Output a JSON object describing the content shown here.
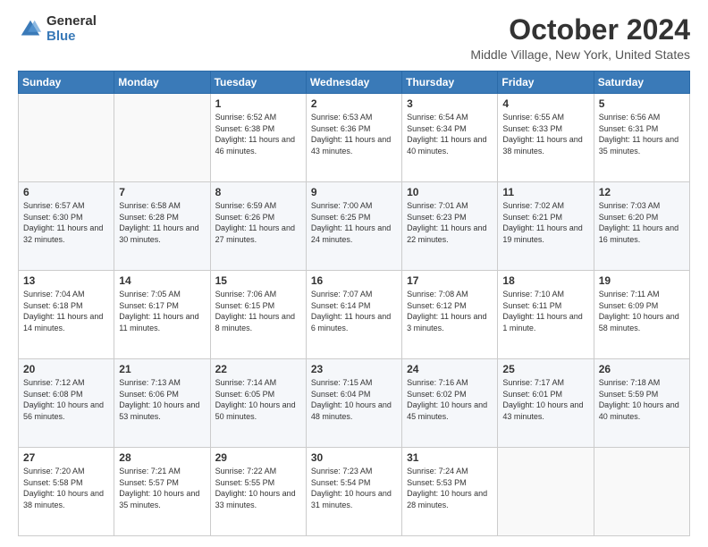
{
  "logo": {
    "general": "General",
    "blue": "Blue"
  },
  "title": "October 2024",
  "location": "Middle Village, New York, United States",
  "days_of_week": [
    "Sunday",
    "Monday",
    "Tuesday",
    "Wednesday",
    "Thursday",
    "Friday",
    "Saturday"
  ],
  "weeks": [
    [
      {
        "day": "",
        "sunrise": "",
        "sunset": "",
        "daylight": ""
      },
      {
        "day": "",
        "sunrise": "",
        "sunset": "",
        "daylight": ""
      },
      {
        "day": "1",
        "sunrise": "Sunrise: 6:52 AM",
        "sunset": "Sunset: 6:38 PM",
        "daylight": "Daylight: 11 hours and 46 minutes."
      },
      {
        "day": "2",
        "sunrise": "Sunrise: 6:53 AM",
        "sunset": "Sunset: 6:36 PM",
        "daylight": "Daylight: 11 hours and 43 minutes."
      },
      {
        "day": "3",
        "sunrise": "Sunrise: 6:54 AM",
        "sunset": "Sunset: 6:34 PM",
        "daylight": "Daylight: 11 hours and 40 minutes."
      },
      {
        "day": "4",
        "sunrise": "Sunrise: 6:55 AM",
        "sunset": "Sunset: 6:33 PM",
        "daylight": "Daylight: 11 hours and 38 minutes."
      },
      {
        "day": "5",
        "sunrise": "Sunrise: 6:56 AM",
        "sunset": "Sunset: 6:31 PM",
        "daylight": "Daylight: 11 hours and 35 minutes."
      }
    ],
    [
      {
        "day": "6",
        "sunrise": "Sunrise: 6:57 AM",
        "sunset": "Sunset: 6:30 PM",
        "daylight": "Daylight: 11 hours and 32 minutes."
      },
      {
        "day": "7",
        "sunrise": "Sunrise: 6:58 AM",
        "sunset": "Sunset: 6:28 PM",
        "daylight": "Daylight: 11 hours and 30 minutes."
      },
      {
        "day": "8",
        "sunrise": "Sunrise: 6:59 AM",
        "sunset": "Sunset: 6:26 PM",
        "daylight": "Daylight: 11 hours and 27 minutes."
      },
      {
        "day": "9",
        "sunrise": "Sunrise: 7:00 AM",
        "sunset": "Sunset: 6:25 PM",
        "daylight": "Daylight: 11 hours and 24 minutes."
      },
      {
        "day": "10",
        "sunrise": "Sunrise: 7:01 AM",
        "sunset": "Sunset: 6:23 PM",
        "daylight": "Daylight: 11 hours and 22 minutes."
      },
      {
        "day": "11",
        "sunrise": "Sunrise: 7:02 AM",
        "sunset": "Sunset: 6:21 PM",
        "daylight": "Daylight: 11 hours and 19 minutes."
      },
      {
        "day": "12",
        "sunrise": "Sunrise: 7:03 AM",
        "sunset": "Sunset: 6:20 PM",
        "daylight": "Daylight: 11 hours and 16 minutes."
      }
    ],
    [
      {
        "day": "13",
        "sunrise": "Sunrise: 7:04 AM",
        "sunset": "Sunset: 6:18 PM",
        "daylight": "Daylight: 11 hours and 14 minutes."
      },
      {
        "day": "14",
        "sunrise": "Sunrise: 7:05 AM",
        "sunset": "Sunset: 6:17 PM",
        "daylight": "Daylight: 11 hours and 11 minutes."
      },
      {
        "day": "15",
        "sunrise": "Sunrise: 7:06 AM",
        "sunset": "Sunset: 6:15 PM",
        "daylight": "Daylight: 11 hours and 8 minutes."
      },
      {
        "day": "16",
        "sunrise": "Sunrise: 7:07 AM",
        "sunset": "Sunset: 6:14 PM",
        "daylight": "Daylight: 11 hours and 6 minutes."
      },
      {
        "day": "17",
        "sunrise": "Sunrise: 7:08 AM",
        "sunset": "Sunset: 6:12 PM",
        "daylight": "Daylight: 11 hours and 3 minutes."
      },
      {
        "day": "18",
        "sunrise": "Sunrise: 7:10 AM",
        "sunset": "Sunset: 6:11 PM",
        "daylight": "Daylight: 11 hours and 1 minute."
      },
      {
        "day": "19",
        "sunrise": "Sunrise: 7:11 AM",
        "sunset": "Sunset: 6:09 PM",
        "daylight": "Daylight: 10 hours and 58 minutes."
      }
    ],
    [
      {
        "day": "20",
        "sunrise": "Sunrise: 7:12 AM",
        "sunset": "Sunset: 6:08 PM",
        "daylight": "Daylight: 10 hours and 56 minutes."
      },
      {
        "day": "21",
        "sunrise": "Sunrise: 7:13 AM",
        "sunset": "Sunset: 6:06 PM",
        "daylight": "Daylight: 10 hours and 53 minutes."
      },
      {
        "day": "22",
        "sunrise": "Sunrise: 7:14 AM",
        "sunset": "Sunset: 6:05 PM",
        "daylight": "Daylight: 10 hours and 50 minutes."
      },
      {
        "day": "23",
        "sunrise": "Sunrise: 7:15 AM",
        "sunset": "Sunset: 6:04 PM",
        "daylight": "Daylight: 10 hours and 48 minutes."
      },
      {
        "day": "24",
        "sunrise": "Sunrise: 7:16 AM",
        "sunset": "Sunset: 6:02 PM",
        "daylight": "Daylight: 10 hours and 45 minutes."
      },
      {
        "day": "25",
        "sunrise": "Sunrise: 7:17 AM",
        "sunset": "Sunset: 6:01 PM",
        "daylight": "Daylight: 10 hours and 43 minutes."
      },
      {
        "day": "26",
        "sunrise": "Sunrise: 7:18 AM",
        "sunset": "Sunset: 5:59 PM",
        "daylight": "Daylight: 10 hours and 40 minutes."
      }
    ],
    [
      {
        "day": "27",
        "sunrise": "Sunrise: 7:20 AM",
        "sunset": "Sunset: 5:58 PM",
        "daylight": "Daylight: 10 hours and 38 minutes."
      },
      {
        "day": "28",
        "sunrise": "Sunrise: 7:21 AM",
        "sunset": "Sunset: 5:57 PM",
        "daylight": "Daylight: 10 hours and 35 minutes."
      },
      {
        "day": "29",
        "sunrise": "Sunrise: 7:22 AM",
        "sunset": "Sunset: 5:55 PM",
        "daylight": "Daylight: 10 hours and 33 minutes."
      },
      {
        "day": "30",
        "sunrise": "Sunrise: 7:23 AM",
        "sunset": "Sunset: 5:54 PM",
        "daylight": "Daylight: 10 hours and 31 minutes."
      },
      {
        "day": "31",
        "sunrise": "Sunrise: 7:24 AM",
        "sunset": "Sunset: 5:53 PM",
        "daylight": "Daylight: 10 hours and 28 minutes."
      },
      {
        "day": "",
        "sunrise": "",
        "sunset": "",
        "daylight": ""
      },
      {
        "day": "",
        "sunrise": "",
        "sunset": "",
        "daylight": ""
      }
    ]
  ]
}
